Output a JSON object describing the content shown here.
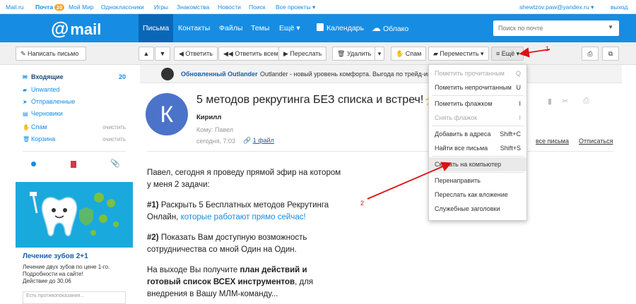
{
  "topbar": {
    "links": [
      "Mail.ru",
      "Почта",
      "Мой Мир",
      "Одноклассники",
      "Игры",
      "Знакомства",
      "Новости",
      "Поиск",
      "Все проекты ▾"
    ],
    "mail_badge": "20",
    "account": "shewtzov.paw@yandex.ru ▾",
    "logout": "выход"
  },
  "header": {
    "logo": "mail",
    "nav": [
      "Письма",
      "Контакты",
      "Файлы",
      "Темы",
      "Ещё ▾",
      "Календарь",
      "Облако"
    ],
    "search_placeholder": "Поиск по почте"
  },
  "toolbar": {
    "compose": "Написать письмо",
    "reply": "Ответить",
    "reply_all": "Ответить всем",
    "forward": "Переслать",
    "delete": "Удалить",
    "spam": "Спам",
    "move": "Переместить ▾",
    "more": "≡ Ещё ▾"
  },
  "folders": [
    {
      "name": "Входящие",
      "count": "20"
    },
    {
      "name": "Unwanted"
    },
    {
      "name": "Отправленные"
    },
    {
      "name": "Черновики"
    },
    {
      "name": "Спам",
      "action": "очистить"
    },
    {
      "name": "Корзина",
      "action": "очистить"
    }
  ],
  "ad": {
    "title": "Лечение зубов 2+1",
    "text1": "Лечение двух зубов по цене 1-го.",
    "text2": "Подробности на сайте!",
    "text3": "Действие до 30.06",
    "footer": "Есть противопоказания..."
  },
  "promo": {
    "title": "Обновленный Outlander",
    "text": "Outlander - новый уровень комфорта. Выгода по трейд-ин"
  },
  "message": {
    "avatar_letter": "К",
    "subject": "5 методов рекрутинга БЕЗ списка и встреч!⚡",
    "sender": "Кирилл",
    "to": "Кому: Павел",
    "date": "сегодня, 7:03",
    "attachment": "1 файл",
    "link_a": "все письма",
    "link_b": "Отписаться",
    "body": {
      "p1a": "Павел, сегодня я проведу прямой эфир на котором",
      "p1b": "у меня 2 задачи:",
      "p2a_bold": "#1)",
      "p2a": " Раскрыть 5 Бесплатных методов Рекрутинга",
      "p2b": "Онлайн, ",
      "p2b_link": "которые работают прямо сейчас!",
      "p3a_bold": "#2)",
      "p3a": " Показать Вам доступную возможность",
      "p3b": "сотрудничества со мной Один на Один.",
      "p4a": "На выходе Вы получите ",
      "p4a_bold": "план действий и",
      "p4b_bold": "готовый список ВСЕХ инструментов",
      "p4b": ", для",
      "p4c": "внедрения в Вашу МЛМ-команду..."
    }
  },
  "dropdown": [
    {
      "label": "Пометить прочитанным",
      "shortcut": "Q"
    },
    {
      "label": "Пометить непрочитанным",
      "shortcut": "U"
    },
    {
      "label": "Пометить флажком",
      "shortcut": "I"
    },
    {
      "label": "Снять флажок",
      "shortcut": "I"
    },
    {
      "label": "Добавить в адреса",
      "shortcut": "Shift+C"
    },
    {
      "label": "Найти все письма",
      "shortcut": "Shift+S"
    },
    {
      "label": "Скачать на компьютер"
    },
    {
      "label": "Перенаправить"
    },
    {
      "label": "Переслать как вложение"
    },
    {
      "label": "Служебные заголовки"
    }
  ],
  "annotations": {
    "one": "1",
    "two": "2"
  }
}
